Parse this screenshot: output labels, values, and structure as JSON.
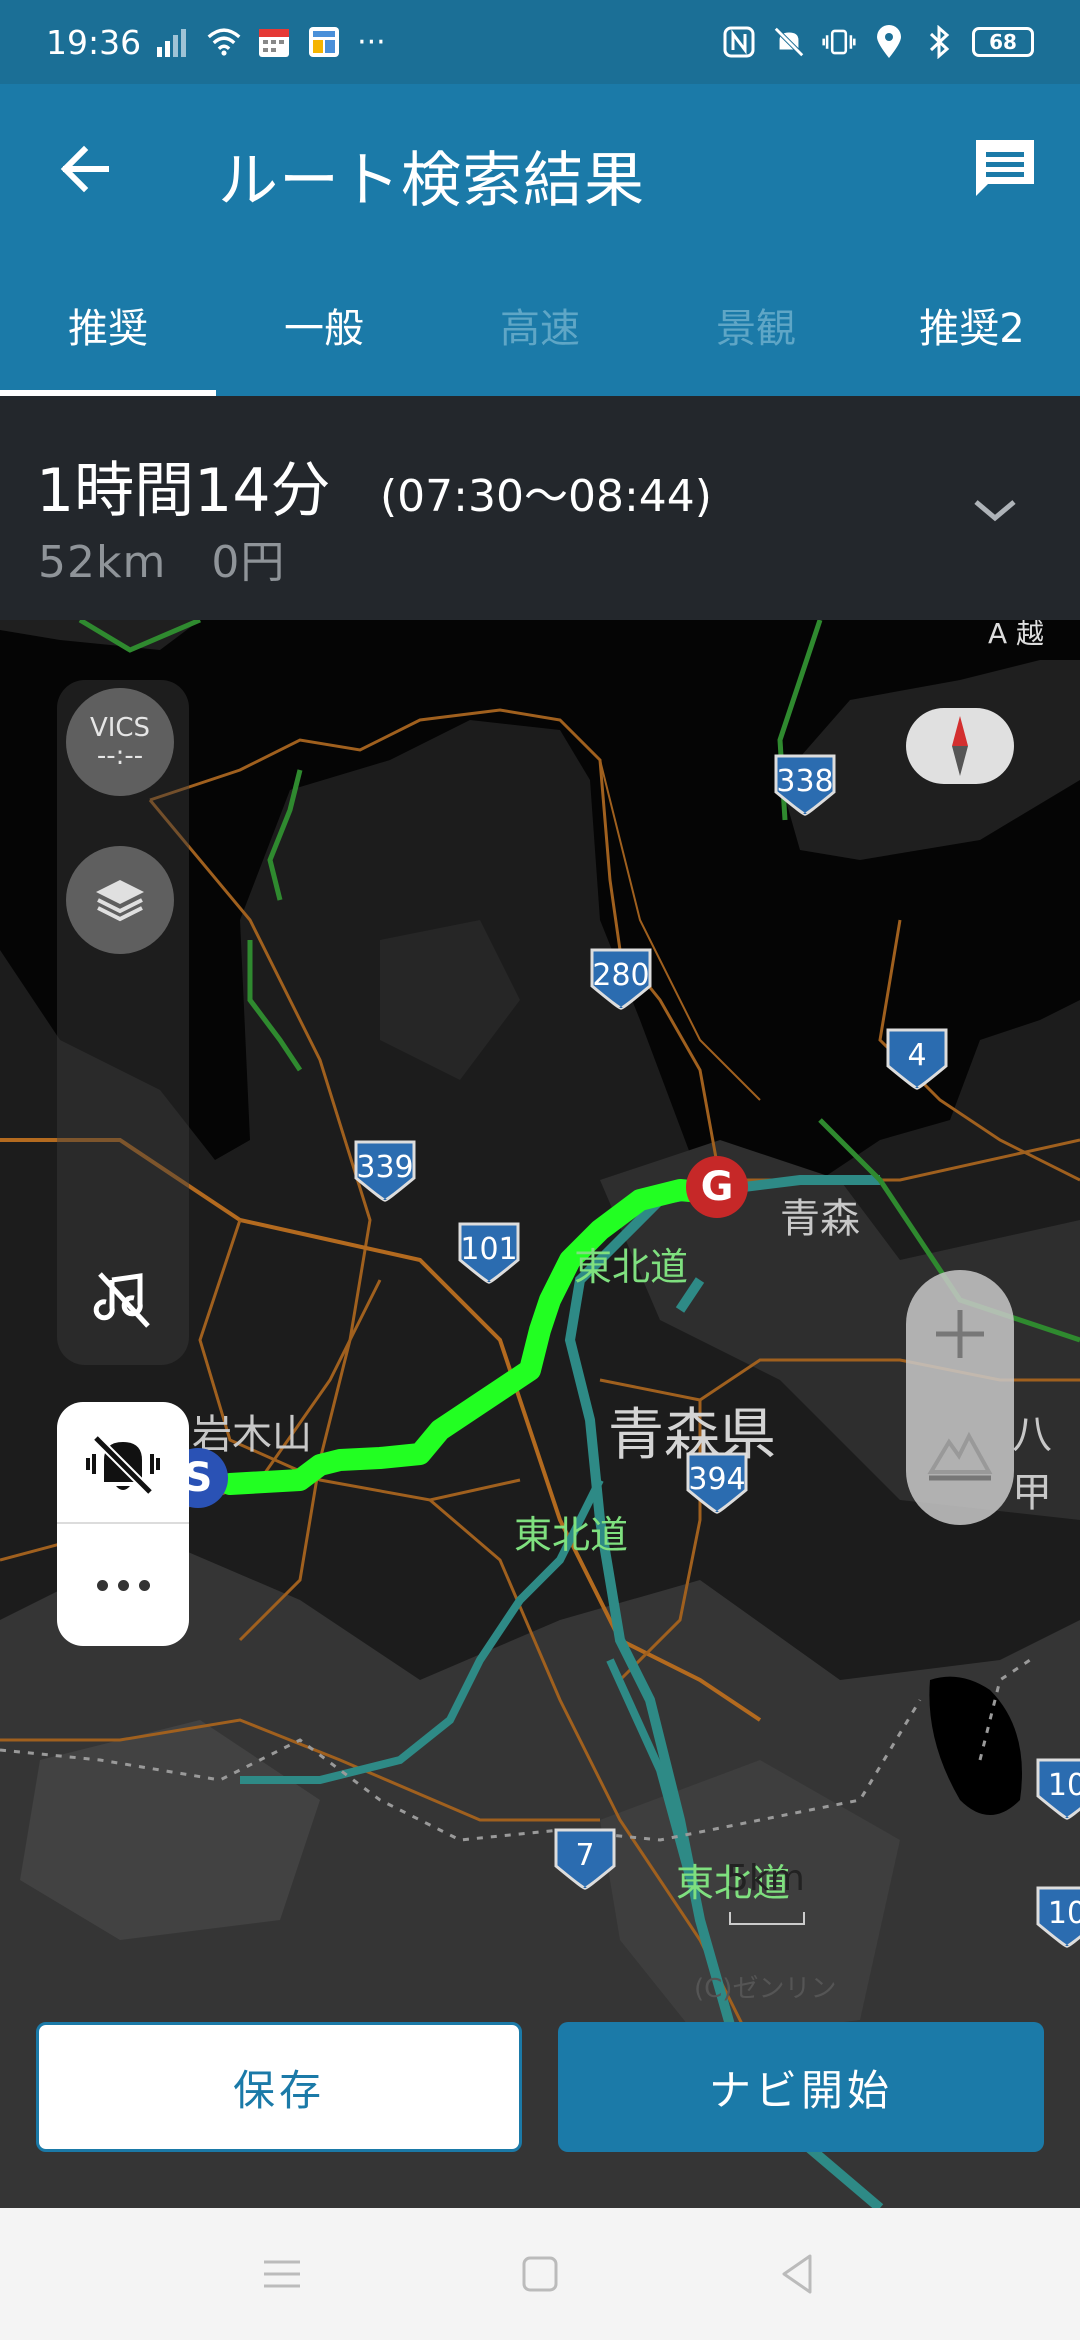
{
  "status_bar": {
    "time": "19:36",
    "dots": "···",
    "battery": "68",
    "icons": [
      "signal-icon",
      "wifi-icon",
      "calendar-icon",
      "app-icon",
      "nfc-icon",
      "vibrate-off-icon",
      "vibrate-icon",
      "location-icon",
      "bluetooth-icon",
      "battery-icon"
    ]
  },
  "app_bar": {
    "title": "ルート検索結果",
    "back_icon": "arrow-left-icon",
    "message_icon": "message-icon"
  },
  "tabs": [
    {
      "label": "推奨",
      "active": true,
      "enabled": true
    },
    {
      "label": "一般",
      "active": false,
      "enabled": true
    },
    {
      "label": "高速",
      "active": false,
      "enabled": false
    },
    {
      "label": "景観",
      "active": false,
      "enabled": false
    },
    {
      "label": "推奨2",
      "active": false,
      "enabled": true
    }
  ],
  "summary": {
    "duration": "1時間14分",
    "time_range": "(07:30〜08:44)",
    "distance_cost": "52km　0円"
  },
  "map": {
    "vics_label": "VICS",
    "vics_sub": "--:--",
    "places": {
      "iwakiyama": "岩木山",
      "aomori_city": "青森",
      "prefecture": "青森県",
      "hachi": "八甲"
    },
    "highways": [
      "東北道",
      "東北道",
      "東北道"
    ],
    "shields": [
      "338",
      "280",
      "4",
      "339",
      "101",
      "394",
      "7",
      "10",
      "10"
    ],
    "goal_marker": "G",
    "start_marker": "S",
    "scale": "5km",
    "copyright": "(C)ゼンリン",
    "top_sign": "A 越"
  },
  "actions": {
    "save": "保存",
    "start_nav": "ナビ開始"
  },
  "nav_bar": {
    "icons": [
      "menu-icon",
      "home-icon",
      "back-icon"
    ]
  },
  "colors": {
    "primary": "#1b7aa8",
    "status_bar": "#1b6f96",
    "route": "#22ff22",
    "goal": "#c62828",
    "start": "#2a52b5"
  }
}
